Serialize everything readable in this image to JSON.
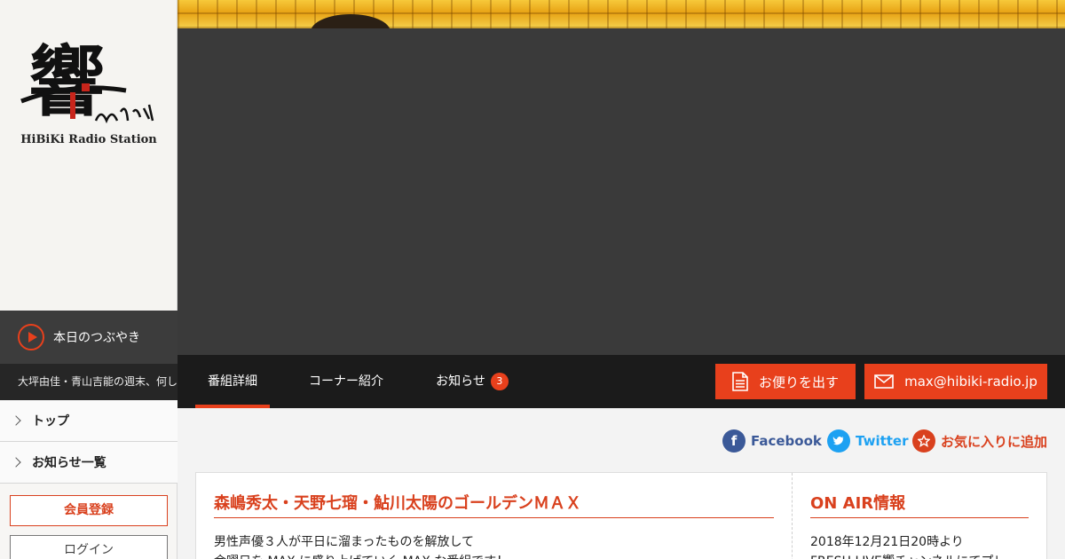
{
  "sidebar": {
    "logo_caption": "HiBiKi Radio Station",
    "logo_text": "響",
    "tweet": {
      "title": "本日のつぶやき",
      "ticker": "大坪由佳・青山吉能の週末、何して"
    },
    "nav": [
      {
        "label": "トップ"
      },
      {
        "label": "お知らせ一覧"
      }
    ],
    "register_label": "会員登録",
    "login_label": "ログイン"
  },
  "tabs": [
    {
      "label": "番組詳細",
      "active": true
    },
    {
      "label": "コーナー紹介",
      "active": false
    },
    {
      "label": "お知らせ",
      "badge": "3",
      "active": false
    }
  ],
  "actions": {
    "letter_label": "お便りを出す",
    "email_label": "max@hibiki-radio.jp"
  },
  "social": {
    "facebook_label": "Facebook",
    "twitter_label": "Twitter",
    "favorite_label": "お気に入りに追加"
  },
  "program": {
    "title": "森嶋秀太・天野七瑠・鮎川太陽のゴールデンＭＡＸ",
    "description": [
      "男性声優３人が平日に溜まったものを解放して",
      "金曜日を MAX に盛り上げていく MAX な番組です！"
    ]
  },
  "onair": {
    "title": "ON AIR情報",
    "lines": [
      "2018年12月21日20時より",
      "FRESH LIVE響チャンネルにてプレ"
    ]
  },
  "colors": {
    "accent": "#e8401c",
    "facebook": "#3b5998",
    "twitter": "#1da1f2",
    "tabbar": "#1b1b1b"
  }
}
